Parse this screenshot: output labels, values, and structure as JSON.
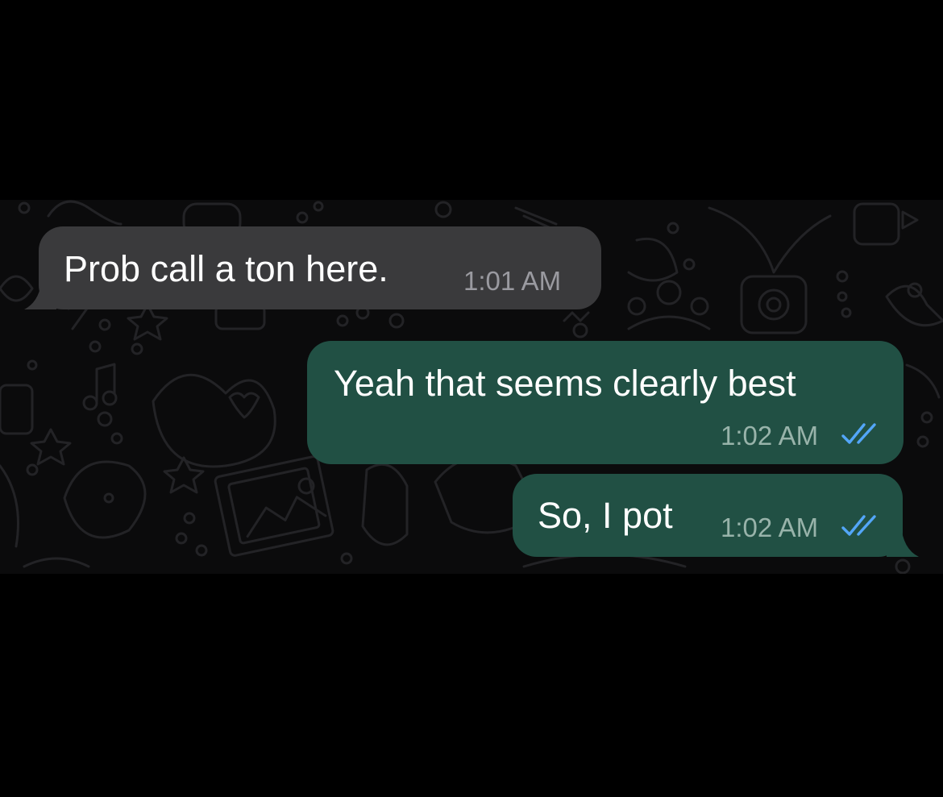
{
  "colors": {
    "background": "#000000",
    "chat_background": "#0b0b0c",
    "incoming_bubble": "#3a3a3c",
    "outgoing_bubble": "#215044",
    "read_receipt": "#53a6f8"
  },
  "messages": [
    {
      "direction": "incoming",
      "text": "Prob call a ton here.",
      "time": "1:01 AM",
      "status_icon": ""
    },
    {
      "direction": "outgoing",
      "text": "Yeah that seems clearly best",
      "time": "1:02 AM",
      "status_icon": "double-check-icon"
    },
    {
      "direction": "outgoing",
      "text": "So, I pot",
      "time": "1:02 AM",
      "status_icon": "double-check-icon"
    }
  ]
}
